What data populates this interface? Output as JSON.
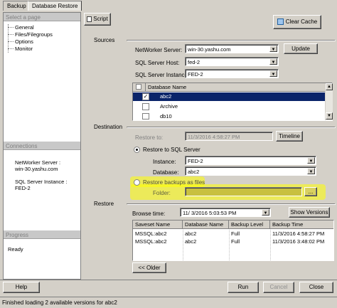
{
  "tabs": [
    {
      "label": "Backup"
    },
    {
      "label": "Database Restore"
    }
  ],
  "left": {
    "select_page_header": "Select a page",
    "pages": [
      "General",
      "Files/Filegroups",
      "Options",
      "Monitor"
    ],
    "connections_header": "Connections",
    "networker_server_label": "NetWorker Server :",
    "networker_server_value": "win-30.yashu.com",
    "sql_instance_label": "SQL Server Instance :",
    "sql_instance_value": "FED-2",
    "progress_header": "Progress",
    "progress_value": "Ready"
  },
  "toolbar": {
    "script_label": "Script",
    "clear_cache_label": "Clear Cache"
  },
  "sources": {
    "section_label": "Sources",
    "networker_server_label": "NetWorker Server:",
    "networker_server_value": "win-30.yashu.com",
    "update_label": "Update",
    "sql_host_label": "SQL Server Host:",
    "sql_host_value": "fed-2",
    "sql_instance_label": "SQL Server Instance:",
    "sql_instance_value": "FED-2",
    "db_header": "Database Name",
    "databases": [
      {
        "name": "abc2",
        "checked": true,
        "selected": true
      },
      {
        "name": "Archive",
        "checked": false,
        "selected": false
      },
      {
        "name": "db10",
        "checked": false,
        "selected": false
      }
    ]
  },
  "destination": {
    "section_label": "Destination",
    "restore_to_label": "Restore to:",
    "restore_to_value": "11/3/2016 4:58:27 PM",
    "timeline_label": "Timeline",
    "restore_to_sql_label": "Restore to SQL Server",
    "instance_label": "Instance:",
    "instance_value": "FED-2",
    "database_label": "Database:",
    "database_value": "abc2",
    "restore_files_label": "Restore backups as files",
    "folder_label": "Folder:",
    "folder_value": "",
    "browse_label": "..."
  },
  "restore": {
    "section_label": "Restore",
    "browse_time_label": "Browse time:",
    "browse_time_value": "11/  3/2016   5:03:53 PM",
    "show_versions_label": "Show Versions",
    "columns": [
      "Saveset Name",
      "Database Name",
      "Backup Level",
      "Backup Time"
    ],
    "rows": [
      [
        "MSSQL:abc2",
        "abc2",
        "Full",
        "11/3/2016 4:58:27 PM"
      ],
      [
        "MSSQL:abc2",
        "abc2",
        "Full",
        "11/3/2016 3:48:02 PM"
      ]
    ],
    "older_label": "<< Older"
  },
  "footer": {
    "help_label": "Help",
    "run_label": "Run",
    "cancel_label": "Cancel",
    "close_label": "Close"
  },
  "status_text": "Finished loading 2 available versions for abc2",
  "colors": {
    "window_bg": "#d4d0c8",
    "selection": "#0a246a",
    "highlight": "#ffff00"
  }
}
